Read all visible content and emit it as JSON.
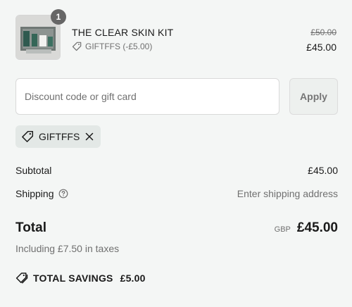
{
  "order_item": {
    "quantity": "1",
    "name": "THE CLEAR SKIN KIT",
    "discount_label": "GIFTFFS (-£5.00)",
    "original_price": "£50.00",
    "price": "£45.00"
  },
  "discount_form": {
    "placeholder": "Discount code or gift card",
    "apply_label": "Apply"
  },
  "applied_code": {
    "code": "GIFTFFS"
  },
  "summary": {
    "subtotal_label": "Subtotal",
    "subtotal_value": "£45.00",
    "shipping_label": "Shipping",
    "shipping_value": "Enter shipping address",
    "total_label": "Total",
    "currency": "GBP",
    "total_value": "£45.00",
    "taxes_note": "Including £7.50 in taxes",
    "savings_label": "TOTAL SAVINGS",
    "savings_value": "£5.00"
  },
  "icons": {
    "tag": "tag-icon",
    "close": "close-icon",
    "help": "help-circle-icon",
    "savings": "tags-icon"
  },
  "colors": {
    "page_background": "#f4f6f5",
    "tag_background": "#e3e8e6",
    "muted_text": "#707070"
  }
}
